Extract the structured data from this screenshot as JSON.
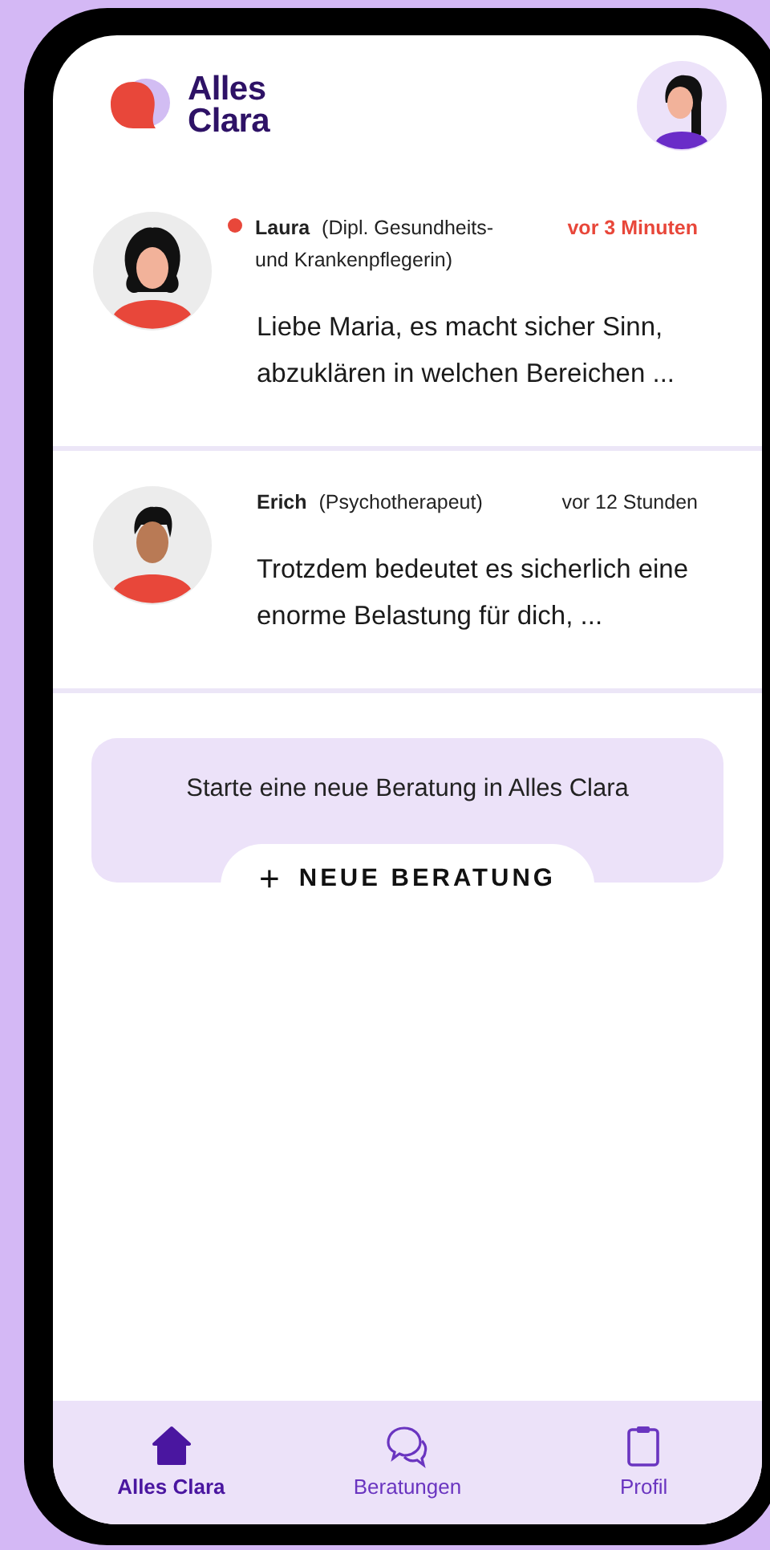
{
  "header": {
    "logo_text": "Alles\nClara"
  },
  "conversations": [
    {
      "name": "Laura",
      "role": "(Dipl. Gesundheits- und Krankenpflegerin)",
      "time": "vor 3 Minuten",
      "unread": true,
      "preview": "Liebe Maria,  es macht sicher Sinn, abzuklären in welchen Bereichen ..."
    },
    {
      "name": "Erich",
      "role": "(Psychotherapeut)",
      "time": "vor 12 Stunden",
      "unread": false,
      "preview": "Trotzdem bedeutet es sicherlich eine enorme Belastung für dich, ..."
    }
  ],
  "new_consultation": {
    "prompt": "Starte eine neue Beratung in Alles Clara",
    "button_icon": "+",
    "button_label": "NEUE BERATUNG"
  },
  "nav": [
    {
      "kind": "home",
      "label": "Alles Clara",
      "selected": true
    },
    {
      "kind": "chat",
      "label": "Beratungen",
      "selected": false
    },
    {
      "kind": "clipboard",
      "label": "Profil",
      "selected": false
    }
  ]
}
